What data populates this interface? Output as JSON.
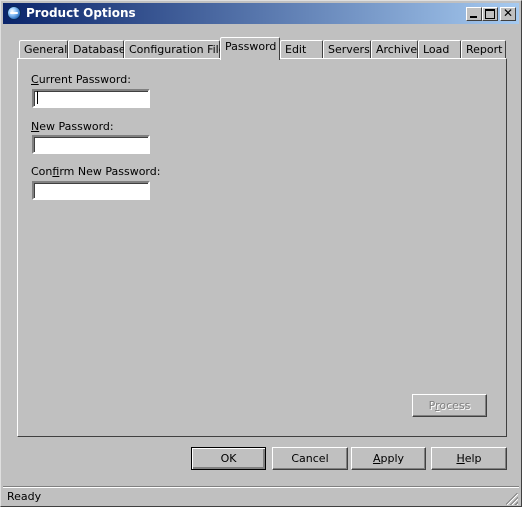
{
  "window": {
    "title": "Product Options",
    "title_icon": "app-globe-icon",
    "controls": [
      "minimize-icon",
      "maximize-icon",
      "close-icon"
    ]
  },
  "tabs": [
    {
      "label": "General"
    },
    {
      "label": "Database"
    },
    {
      "label": "Configuration File"
    },
    {
      "label": "Password",
      "active": true
    },
    {
      "label": "Edit"
    },
    {
      "label": "Servers"
    },
    {
      "label": "Archive"
    },
    {
      "label": "Load"
    },
    {
      "label": "Report"
    }
  ],
  "password_panel": {
    "current_label_key": "C",
    "current_label_rest": "urrent Password:",
    "current_value": "",
    "new_label_key": "N",
    "new_label_rest": "ew Password:",
    "new_value": "",
    "confirm_label_pre": "Con",
    "confirm_label_key": "f",
    "confirm_label_rest": "irm New Password:",
    "confirm_value": "",
    "process_label_pre": "P",
    "process_label_key": "r",
    "process_label_rest": "ocess"
  },
  "buttons": {
    "ok": "OK",
    "cancel": "Cancel",
    "apply_key": "A",
    "apply_rest": "pply",
    "help_key": "H",
    "help_rest": "elp"
  },
  "status": {
    "text": "Ready"
  }
}
